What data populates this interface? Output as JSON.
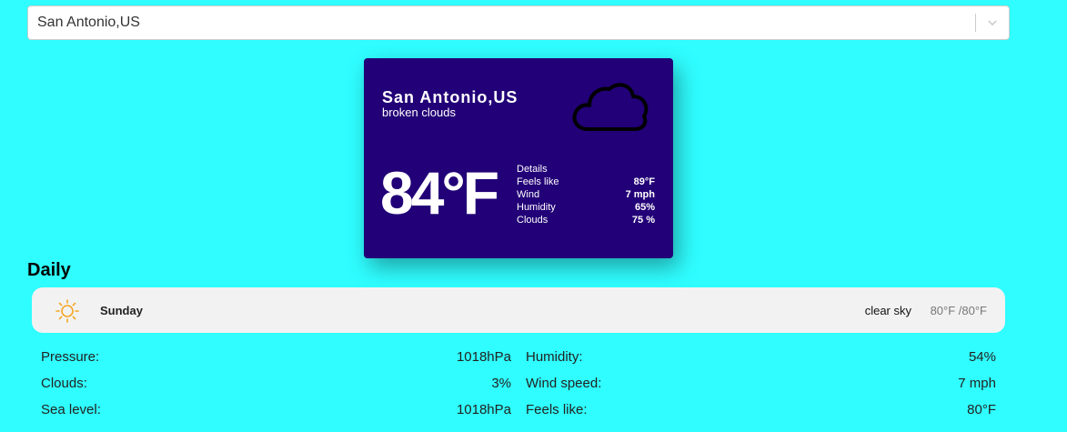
{
  "search": {
    "value": "San Antonio,US"
  },
  "current": {
    "city": "San Antonio,US",
    "description": "broken clouds",
    "icon": "cloud-icon",
    "temperature": "84°F",
    "details_header": "Details",
    "details": [
      {
        "label": "Feels like",
        "value": "89°F"
      },
      {
        "label": "Wind",
        "value": "7 mph"
      },
      {
        "label": "Humidity",
        "value": "65%"
      },
      {
        "label": "Clouds",
        "value": "75 %"
      }
    ]
  },
  "daily": {
    "title": "Daily",
    "day": {
      "icon": "sun-icon",
      "name": "Sunday",
      "description": "clear sky",
      "range": "80°F /80°F"
    },
    "stats": [
      {
        "label": "Pressure:",
        "value": "1018hPa"
      },
      {
        "label": "Humidity:",
        "value": "54%"
      },
      {
        "label": "Clouds:",
        "value": "3%"
      },
      {
        "label": "Wind speed:",
        "value": "7 mph"
      },
      {
        "label": "Sea level:",
        "value": "1018hPa"
      },
      {
        "label": "Feels like:",
        "value": "80°F"
      }
    ]
  },
  "colors": {
    "background": "#2ffdff",
    "card": "#220077",
    "sun": "#f5a623"
  }
}
